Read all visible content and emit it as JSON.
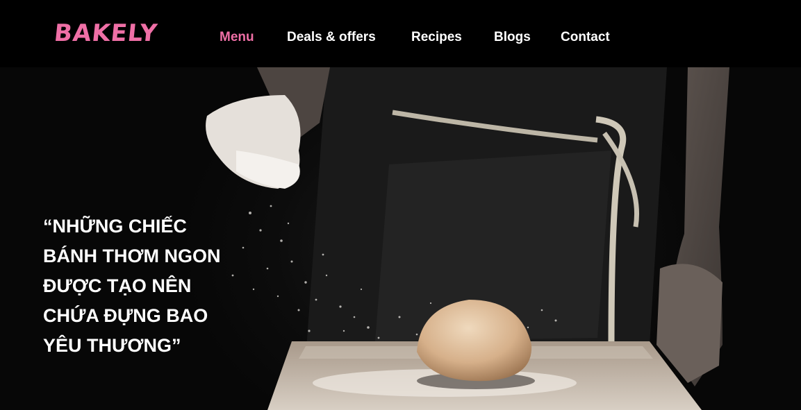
{
  "brand": {
    "logo_text": "BAKELY",
    "accent_color": "#ef6fa6"
  },
  "nav": {
    "items": [
      {
        "label": "Menu",
        "active": true
      },
      {
        "label": "Deals & offers",
        "active": false
      },
      {
        "label": "Recipes",
        "active": false
      },
      {
        "label": "Blogs",
        "active": false
      },
      {
        "label": "Contact",
        "active": false
      }
    ]
  },
  "hero": {
    "quote_lines": [
      "“NHỮNG CHIẾC",
      "BÁNH THƠM NGON",
      "ĐƯỢC TẠO NÊN",
      "CHỨA ĐỰNG BAO",
      "YÊU THƯƠNG”"
    ],
    "image": "baker-kneading-dough-with-flour"
  }
}
